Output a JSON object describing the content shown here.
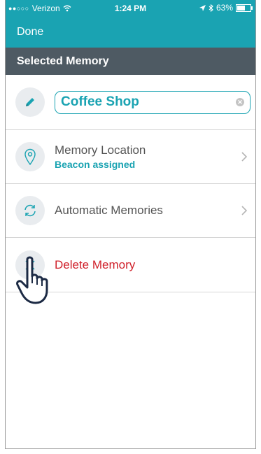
{
  "status_bar": {
    "carrier": "Verizon",
    "time": "1:24 PM",
    "battery": "63%",
    "battery_level": 0.63
  },
  "nav": {
    "done_label": "Done"
  },
  "section": {
    "title": "Selected Memory"
  },
  "name_field": {
    "value": "Coffee Shop"
  },
  "rows": {
    "location": {
      "title": "Memory Location",
      "subtitle": "Beacon assigned"
    },
    "automatic": {
      "title": "Automatic Memories"
    },
    "delete": {
      "title": "Delete Memory"
    }
  },
  "colors": {
    "accent": "#1aa3b2",
    "header": "#4e5a63",
    "danger": "#d0202a",
    "icon_bg": "#e9ecef"
  }
}
